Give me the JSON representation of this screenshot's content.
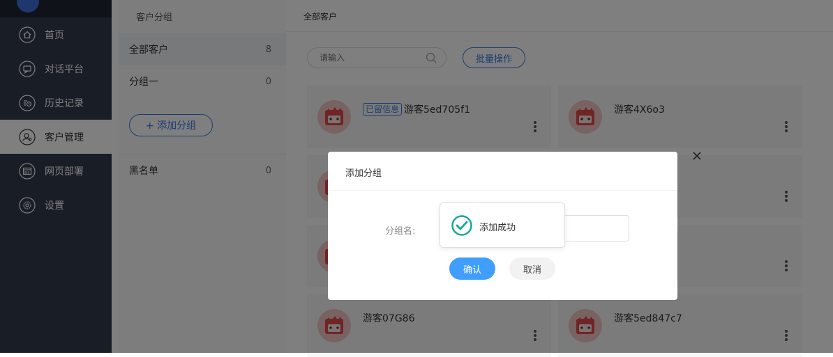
{
  "sidebar": {
    "items": [
      {
        "label": "首页",
        "icon": "home-icon"
      },
      {
        "label": "对话平台",
        "icon": "chat-icon"
      },
      {
        "label": "历史记录",
        "icon": "history-icon"
      },
      {
        "label": "客户管理",
        "icon": "customer-icon",
        "active": true
      },
      {
        "label": "网页部署",
        "icon": "webpage-icon"
      },
      {
        "label": "设置",
        "icon": "settings-icon"
      }
    ]
  },
  "groups": {
    "title": "客户分组",
    "items": [
      {
        "label": "全部客户",
        "count": "8",
        "selected": true
      },
      {
        "label": "分组一",
        "count": "0"
      }
    ],
    "add_label": "+ 添加分组",
    "blacklist": {
      "label": "黑名单",
      "count": "0"
    }
  },
  "main": {
    "title": "全部客户",
    "search_placeholder": "请输入",
    "batch_label": "批量操作",
    "cards": [
      {
        "tag": "已留信息",
        "name": "游客5ed705f1"
      },
      {
        "name": "游客4X6o3"
      },
      {
        "name": ""
      },
      {
        "name": ""
      },
      {
        "name": ""
      },
      {
        "name": ""
      },
      {
        "name": "游客07G86"
      },
      {
        "name": "游客5ed847c7"
      }
    ]
  },
  "dialog": {
    "title": "添加分组",
    "field_label": "分组名:",
    "field_value": "",
    "ok_label": "确认",
    "cancel_label": "取消"
  },
  "toast": {
    "text": "添加成功"
  },
  "colors": {
    "sidebar_bg": "#323a4c",
    "accent": "#3a7be0",
    "primary_button": "#409eff",
    "success": "#13a89e",
    "avatar_red": "#e04a4a"
  }
}
